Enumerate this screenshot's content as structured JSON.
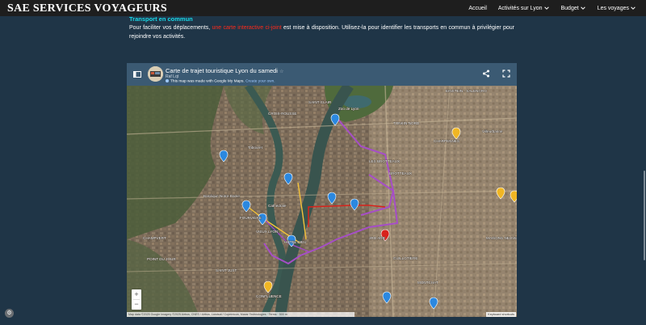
{
  "site": {
    "title": "SAE SERVICES VOYAGEURS"
  },
  "nav": {
    "items": [
      {
        "label": "Accueil",
        "has_dropdown": false
      },
      {
        "label": "Activités sur Lyon",
        "has_dropdown": true
      },
      {
        "label": "Budget",
        "has_dropdown": true
      },
      {
        "label": "Les voyages",
        "has_dropdown": true
      }
    ]
  },
  "content": {
    "heading": "Transport en commun",
    "intro_before": "Pour faciliter vos déplacements, ",
    "intro_highlight": "une carte interactive ci-joint",
    "intro_after": " est mise à disposition. Utilisez-la pour identifier les transports en commun à privilégier pour rejoindre vos activités."
  },
  "map": {
    "title": "Carte de trajet touristique Lyon du samedi",
    "author": "Raf Lqt",
    "notice_text": "This map was made with Google My Maps.",
    "notice_link": "Create your own.",
    "zoom_in": "+",
    "zoom_out": "−",
    "attribution": "Map data ©2025 Google Imagery ©2025 Airbus, CNES / Airbus, Landsat / Copernicus, Maxar Technologies · Terms · 500 m",
    "keyboard_shortcuts": "Keyboard shortcuts",
    "labels": [
      "Zoo de Lyon",
      "EINSTEIN - SALENGRO",
      "CROIX-ROUSSE",
      "TONKIN-NORD",
      "SAINT-CLAIR",
      "CHARPENNES",
      "Villeurbanne",
      "Tabouret",
      "LES BROTTEAUX",
      "BROTTEAUX",
      "Basilique Notre-Dame",
      "FOURVIÈRE",
      "VIEUX LYON",
      "Cathédrale",
      "HÔTEL DIEU",
      "CHAMPVERT",
      "POINT DU JOUR",
      "3RD ARR",
      "GUILLOTIÈRE",
      "MONTCHAT",
      "MAISONS NEUVES",
      "SAINT-JUST",
      "CONFLUENCE"
    ]
  },
  "colors": {
    "header_bar": "#1e1e1e",
    "page_bg": "#1f3547",
    "heading": "#19d9e8",
    "highlight": "#ff2a1a",
    "map_header": "#3b5a73",
    "route_purple": "#a64ec7",
    "route_red": "#d8231c",
    "route_yellow": "#f3c23a",
    "marker_blue": "#2b88e0",
    "marker_gold": "#f0b624"
  },
  "icons": {
    "panel": "panel-toggle-icon",
    "share": "share-icon",
    "fullscreen": "fullscreen-icon",
    "chevron": "chevron-down-icon",
    "fab": "settings-fab-icon"
  }
}
